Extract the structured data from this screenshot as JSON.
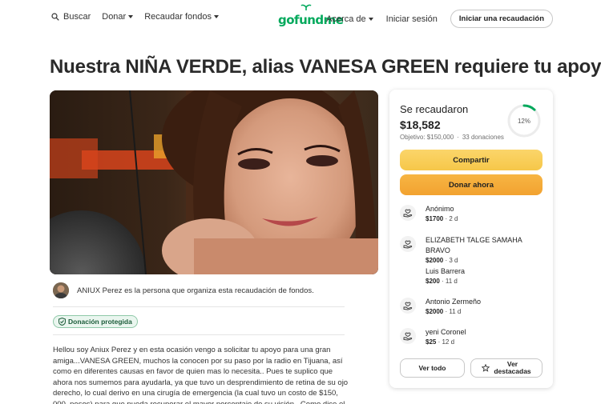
{
  "nav": {
    "search": "Buscar",
    "donate": "Donar",
    "fundraise": "Recaudar fondos",
    "logo": "gofundme",
    "about": "Acerca de",
    "signin": "Iniciar sesión",
    "start": "Iniciar una recaudación"
  },
  "title": "Nuestra NIÑA VERDE, alias VANESA GREEN requiere tu apoyo",
  "organizer": {
    "text": "ANIUX Perez es la persona que organiza esta recaudación de fondos."
  },
  "badge": "Donación protegida",
  "story": "Hellou soy Aniux Perez y en esta ocasión vengo a solicitar tu apoyo para una gran amiga...VANESA GREEN, muchos la conocen por su paso por la radio en Tijuana, así como en diferentes causas en favor de quien mas lo necesita.. Pues te suplico que ahora nos sumemos para ayudarla, ya que tuvo un desprendimiento de retina de su ojo derecho, lo cual derivo en una cirugía de emergencia (la cual tuvo un costo de $150, 000. pesos) para que pueda recuperar el mayor porcentaje de su visión.. Como dice el dicho los ojos son la",
  "card": {
    "raised_label": "Se recaudaron",
    "raised_amount": "$18,582",
    "goal": "Objetivo: $150,000",
    "donations": "33 donaciones",
    "progress_label": "12%",
    "progress": 0.12,
    "share": "Compartir",
    "donate_now": "Donar ahora",
    "see_all": "Ver todo",
    "see_top_line1": "Ver",
    "see_top_line2": "destacadas"
  },
  "donations": [
    {
      "name": "Anónimo",
      "amount": "$1700",
      "time": "2 d"
    },
    {
      "name": "ELIZABETH TALGE SAMAHA BRAVO",
      "amount": "$2000",
      "time": "3 d"
    },
    {
      "name": "Luis Barrera",
      "amount": "$200",
      "time": "11 d"
    },
    {
      "name": "Antonio Zermeño",
      "amount": "$2000",
      "time": "11 d"
    },
    {
      "name": "yeni Coronel",
      "amount": "$25",
      "time": "12 d"
    }
  ],
  "colors": {
    "brand": "#02a95c",
    "share_button": "#f6c749",
    "donate_button": "#f2a230"
  }
}
